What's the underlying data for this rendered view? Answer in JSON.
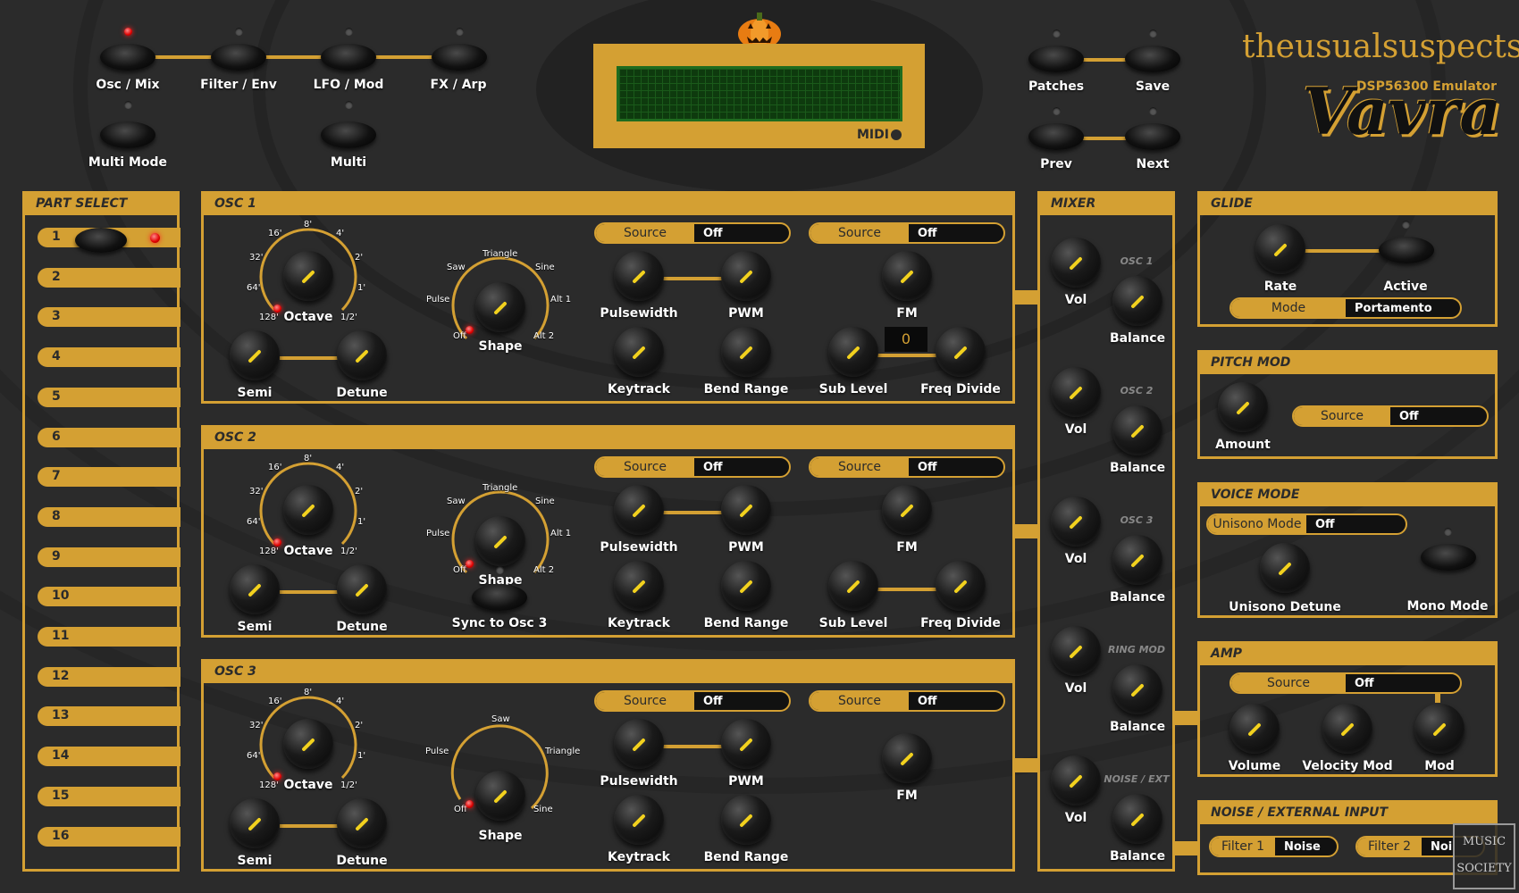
{
  "header": {
    "nav_buttons": [
      {
        "label": "Osc / Mix",
        "active": true
      },
      {
        "label": "Filter / Env",
        "active": false
      },
      {
        "label": "LFO / Mod",
        "active": false
      },
      {
        "label": "FX / Arp",
        "active": false
      },
      {
        "label": "Multi Mode",
        "active": false
      },
      {
        "label": "Multi",
        "active": false
      }
    ],
    "patch_buttons": [
      "Patches",
      "Save",
      "Prev",
      "Next"
    ],
    "midi_label": "MIDI",
    "brand": "theusualsuspects",
    "subtitle": "DSP56300 Emulator",
    "product": "Vavra"
  },
  "part_select": {
    "title": "PART SELECT",
    "parts": [
      "1",
      "2",
      "3",
      "4",
      "5",
      "6",
      "7",
      "8",
      "9",
      "10",
      "11",
      "12",
      "13",
      "14",
      "15",
      "16"
    ],
    "selected": "1"
  },
  "osc1": {
    "title": "OSC 1",
    "octave_ticks": [
      "16'",
      "8'",
      "4'",
      "32'",
      "2'",
      "64'",
      "1'",
      "128'",
      "1/2'"
    ],
    "octave_label": "Octave",
    "shape_ticks": [
      "Triangle",
      "Saw",
      "Sine",
      "Pulse",
      "Alt 1",
      "Off",
      "Alt 2"
    ],
    "shape_label": "Shape",
    "semi_label": "Semi",
    "detune_label": "Detune",
    "source1": {
      "label": "Source",
      "value": "Off"
    },
    "source2": {
      "label": "Source",
      "value": "Off"
    },
    "pulsewidth_label": "Pulsewidth",
    "pwm_label": "PWM",
    "fm_label": "FM",
    "keytrack_label": "Keytrack",
    "bendrange_label": "Bend Range",
    "sublevel_label": "Sub Level",
    "freqdivide_label": "Freq Divide",
    "freqdivide_value": "0"
  },
  "osc2": {
    "title": "OSC 2",
    "octave_ticks": [
      "16'",
      "8'",
      "4'",
      "32'",
      "2'",
      "64'",
      "1'",
      "128'",
      "1/2'"
    ],
    "octave_label": "Octave",
    "shape_ticks": [
      "Triangle",
      "Saw",
      "Sine",
      "Pulse",
      "Alt 1",
      "Off",
      "Alt 2"
    ],
    "shape_label": "Shape",
    "semi_label": "Semi",
    "detune_label": "Detune",
    "sync_label": "Sync to Osc 3",
    "source1": {
      "label": "Source",
      "value": "Off"
    },
    "source2": {
      "label": "Source",
      "value": "Off"
    },
    "pulsewidth_label": "Pulsewidth",
    "pwm_label": "PWM",
    "fm_label": "FM",
    "keytrack_label": "Keytrack",
    "bendrange_label": "Bend Range",
    "sublevel_label": "Sub Level",
    "freqdivide_label": "Freq Divide"
  },
  "osc3": {
    "title": "OSC 3",
    "octave_ticks": [
      "16'",
      "8'",
      "4'",
      "32'",
      "2'",
      "64'",
      "1'",
      "128'",
      "1/2'"
    ],
    "octave_label": "Octave",
    "shape_ticks": [
      "Saw",
      "Pulse",
      "Triangle",
      "Off",
      "Sine"
    ],
    "shape_label": "Shape",
    "semi_label": "Semi",
    "detune_label": "Detune",
    "source1": {
      "label": "Source",
      "value": "Off"
    },
    "source2": {
      "label": "Source",
      "value": "Off"
    },
    "pulsewidth_label": "Pulsewidth",
    "pwm_label": "PWM",
    "fm_label": "FM",
    "keytrack_label": "Keytrack",
    "bendrange_label": "Bend Range"
  },
  "mixer": {
    "title": "MIXER",
    "channels": [
      {
        "name": "OSC 1",
        "vol": "Vol",
        "balance": "Balance"
      },
      {
        "name": "OSC 2",
        "vol": "Vol",
        "balance": "Balance"
      },
      {
        "name": "OSC 3",
        "vol": "Vol",
        "balance": "Balance"
      },
      {
        "name": "RING MOD",
        "vol": "Vol",
        "balance": "Balance"
      },
      {
        "name": "NOISE / EXT",
        "vol": "Vol",
        "balance": "Balance"
      }
    ]
  },
  "glide": {
    "title": "GLIDE",
    "rate_label": "Rate",
    "active_label": "Active",
    "mode": {
      "label": "Mode",
      "value": "Portamento"
    }
  },
  "pitch_mod": {
    "title": "PITCH MOD",
    "amount_label": "Amount",
    "source": {
      "label": "Source",
      "value": "Off"
    }
  },
  "voice_mode": {
    "title": "VOICE MODE",
    "unisono": {
      "label": "Unisono Mode",
      "value": "Off"
    },
    "unisono_detune_label": "Unisono Detune",
    "mono_label": "Mono Mode"
  },
  "amp": {
    "title": "AMP",
    "source": {
      "label": "Source",
      "value": "Off"
    },
    "volume_label": "Volume",
    "velocity_label": "Velocity Mod",
    "mod_label": "Mod"
  },
  "noise": {
    "title": "NOISE / EXTERNAL INPUT",
    "filter1": {
      "label": "Filter 1",
      "value": "Noise"
    },
    "filter2": {
      "label": "Filter 2",
      "value": "Noi"
    }
  },
  "watermark": "MUSIC SOCIETY",
  "colors": {
    "accent": "#d4a033",
    "knob_indicator": "#f2d11e",
    "background": "#2b2b2b",
    "led": "#e00000"
  }
}
